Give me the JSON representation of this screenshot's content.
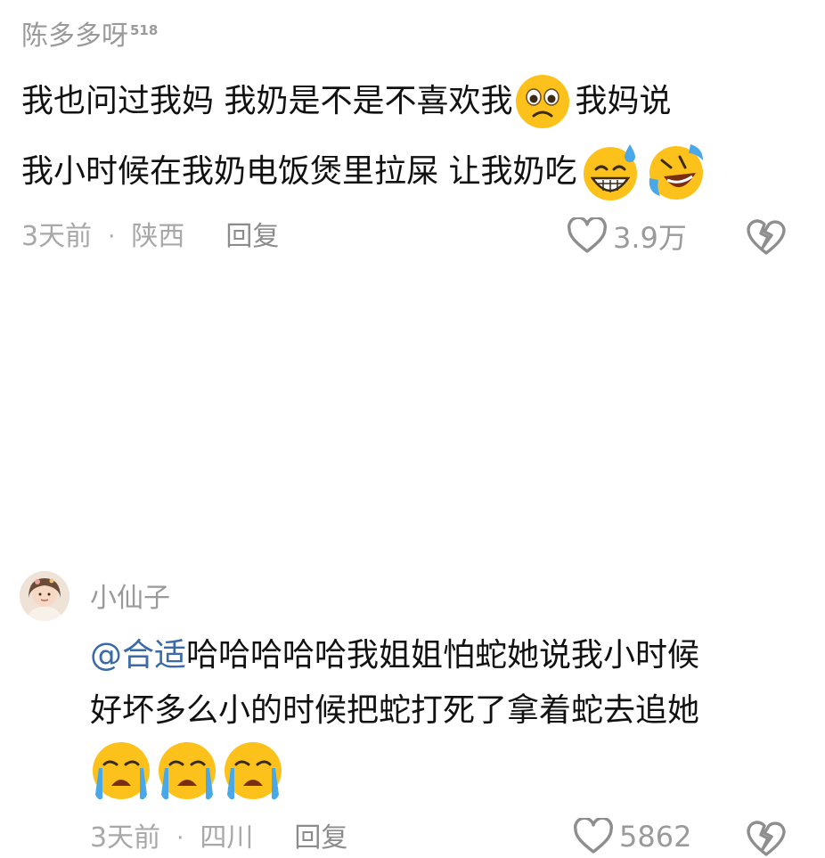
{
  "comments": [
    {
      "author": "陈多多呀",
      "author_badge": "518",
      "lines": [
        {
          "text": "我也问过我妈 我奶是不是不喜欢我",
          "emoji_after": "frowning-emoji",
          "text2": " 我妈说"
        },
        {
          "text": "我小时候在我奶电饭煲里拉屎 让我奶吃",
          "emojis": [
            "grinning-sweat-emoji",
            "rolling-laughing-emoji"
          ]
        }
      ],
      "time": "3天前",
      "location": "陕西",
      "reply_label": "回复",
      "likes": "3.9万",
      "dislike_icon": "broken-heart-icon",
      "like_icon": "heart-outline-icon"
    },
    {
      "author": "小仙子",
      "avatar_icon": "avatar-photo",
      "mention": "@合适",
      "lines": [
        {
          "text": " 哈哈哈哈哈我姐姐怕蛇她说我小时候"
        },
        {
          "text": "好坏多么小的时候把蛇打死了拿着蛇去追她"
        }
      ],
      "emojis": [
        "crying-emoji",
        "crying-emoji",
        "crying-emoji"
      ],
      "time": "3天前",
      "location": "四川",
      "reply_label": "回复",
      "likes": "5862",
      "dislike_icon": "broken-heart-icon",
      "like_icon": "heart-outline-icon"
    }
  ],
  "meta_separator": "·",
  "colors": {
    "text": "#111111",
    "muted": "#9a9a9a",
    "mention": "#3a6aa8",
    "emoji_yellow": "#fcc21b"
  }
}
